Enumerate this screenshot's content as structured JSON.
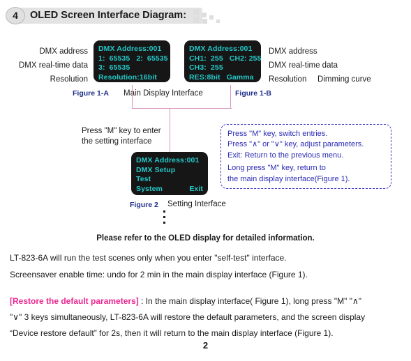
{
  "header": {
    "number": "4",
    "title": "OLED Screen Interface Diagram:"
  },
  "left_labels": {
    "dmx_address": "DMX address",
    "realtime": "DMX real-time data",
    "resolution": "Resolution"
  },
  "right_labels": {
    "dmx_address": "DMX address",
    "realtime": "DMX real-time data",
    "resolution": "Resolution",
    "dimming": "Dimming curve"
  },
  "oled_a": {
    "line1": "DMX Address:001",
    "line2": "1:  65535   2:  65535",
    "line3": "3:  65535",
    "line4": "Resolution:16bit"
  },
  "oled_b": {
    "line1": "DMX Address:001",
    "line2": "CH1:  255   CH2: 255",
    "line3": "CH3:  255",
    "line4": "RES:8bit   Gamma"
  },
  "oled_setting": {
    "line1": "DMX Address:001",
    "line2": "DMX Setup",
    "line3": "Test",
    "line4_left": "System",
    "line4_right": "Exit"
  },
  "captions": {
    "figure_1a": "Figure 1-A",
    "figure_1b": "Figure 1-B",
    "figure_2": "Figure 2",
    "main_display": "Main Display Interface",
    "setting_interface": "Setting Interface"
  },
  "press_note": {
    "line1": "Press \"M\" key to enter",
    "line2": "the setting interface"
  },
  "instructions": {
    "line1": "Press \"M\" key,  switch entries.",
    "line2": "Press \"∧\" or \"∨\" key,  adjust parameters.",
    "line3": "Exit: Return to the previous menu.",
    "line4": "Long press \"M\" key,  return to",
    "line5": "the main display interface(Figure 1)."
  },
  "refer_note": "Please refer to the OLED display for detailed information.",
  "body": {
    "line1": "LT-823-6A will run the test scenes only when you enter \"self-test\" interface.",
    "line2": "Screensaver enable time: undo for 2 min in the main display interface (Figure 1).",
    "restore_tag": "[Restore the default parameters]",
    "line3_rest": " : In the main display interface( Figure 1), long press \"M\" \"∧\"",
    "line4": "\"∨\" 3 keys simultaneously, LT-823-6A will restore the default parameters, and the screen display",
    "line5": "“Device restore default” for 2s, then it will return to the main display interface (Figure 1)."
  },
  "page_number": "2",
  "colors": {
    "oled_text": "#24c8c8",
    "oled_bg": "#161616",
    "figure_caption": "#1f2f8a",
    "connector": "#d894bd",
    "instruction": "#2a2ab4",
    "highlight": "#ec268f",
    "header_bar": "#e3e3e3"
  }
}
